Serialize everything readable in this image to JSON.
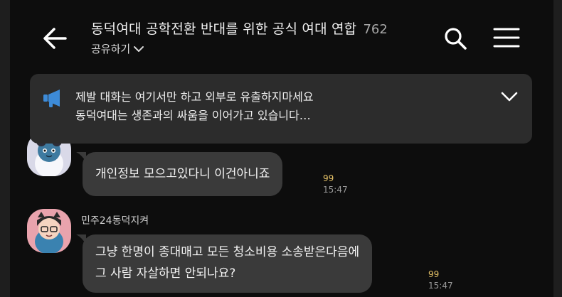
{
  "header": {
    "title": "동덕여대 공학전환 반대를 위한 공식 여대 연합",
    "member_count": "762",
    "share_label": "공유하기",
    "icons": {
      "back": "arrow-left-icon",
      "share_dropdown": "chevron-down-icon",
      "search": "search-icon",
      "menu": "hamburger-menu-icon"
    }
  },
  "notice": {
    "icon": "megaphone-icon",
    "line1": "제발 대화는 여기서만 하고 외부로 유출하지마세요",
    "line2": "동덕여대는 생존과의 싸움을 이어가고 있습니다…",
    "toggle_icon": "chevron-down-icon"
  },
  "messages": [
    {
      "sender": "",
      "text_lines": [
        "개인정보 모으고있다니 이건아니죠"
      ],
      "unread": "99",
      "time": "15:47"
    },
    {
      "sender": "민주24동덕지켜",
      "text_lines": [
        "그냥 한명이 종대매고 모든 청소비용 소송받은다음에",
        "그 사람 자살하면 안되나요?"
      ],
      "unread": "99",
      "time": "15:47"
    }
  ],
  "colors": {
    "background": "#0d0d0d",
    "bubble": "#3a3a3a",
    "notice": "#2c2c2c",
    "notice_icon": "#3d8bd8",
    "unread": "#e8c468"
  }
}
